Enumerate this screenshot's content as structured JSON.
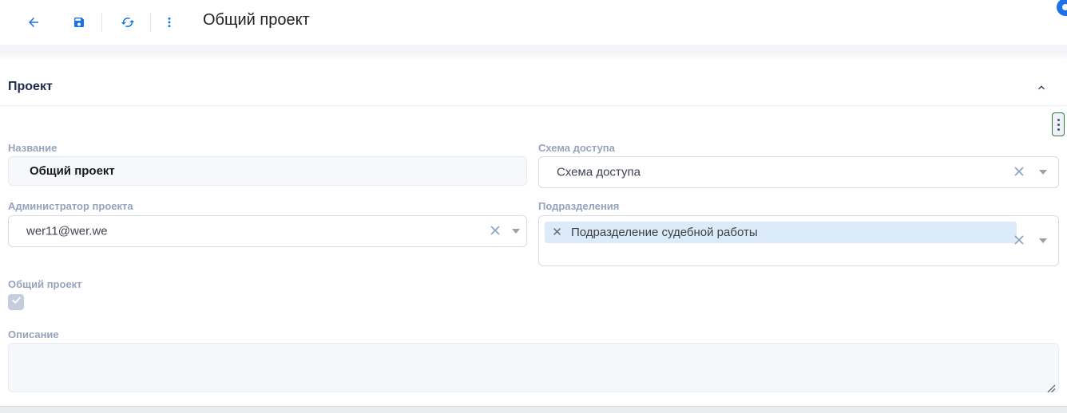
{
  "toolbar": {
    "title": "Общий проект",
    "icons": {
      "back": "arrow-left",
      "save": "floppy-disk",
      "refresh": "sync-arrows",
      "menu": "more-vert",
      "badge": "notification-circle"
    }
  },
  "section": {
    "title": "Проект",
    "collapse_icon": "chevron-up",
    "menu_icon": "more-vert"
  },
  "form": {
    "name": {
      "label": "Название",
      "value": "Общий проект"
    },
    "access_scheme": {
      "label": "Схема доступа",
      "value": "Схема доступа"
    },
    "admin": {
      "label": "Администратор проекта",
      "value": "wer11@wer.we"
    },
    "departments": {
      "label": "Подразделения",
      "chips": [
        "Подразделение судебной работы"
      ]
    },
    "shared": {
      "label": "Общий проект",
      "checked": true
    },
    "description": {
      "label": "Описание",
      "value": ""
    }
  },
  "colors": {
    "accent": "#1a73e8",
    "label": "#95a3bd",
    "chip_background": "#dcebfa",
    "checkbox_disabled": "#c4cddc",
    "section_menu_border": "#2e7d32",
    "bottom_bar": "#ebeced"
  }
}
